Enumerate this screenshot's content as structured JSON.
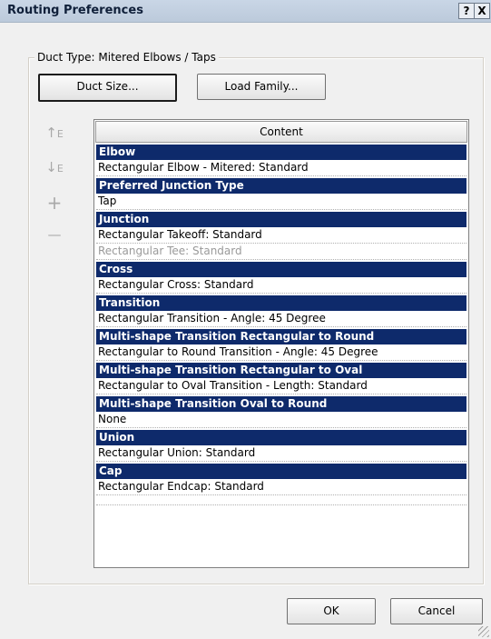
{
  "window": {
    "title": "Routing Preferences",
    "help_glyph": "?",
    "close_glyph": "X"
  },
  "group": {
    "legend": "Duct Type: Mitered Elbows / Taps",
    "duct_size_label": "Duct Size...",
    "load_family_label": "Load Family..."
  },
  "toolbar": {
    "move_up_glyph": "↑",
    "move_down_glyph": "↓",
    "add_glyph": "+",
    "remove_glyph": "—"
  },
  "grid": {
    "header": "Content",
    "sections": [
      {
        "title": "Elbow",
        "rows": [
          {
            "text": "Rectangular Elbow - Mitered: Standard",
            "disabled": false
          }
        ]
      },
      {
        "title": "Preferred Junction Type",
        "rows": [
          {
            "text": "Tap",
            "disabled": false
          }
        ]
      },
      {
        "title": "Junction",
        "rows": [
          {
            "text": "Rectangular Takeoff: Standard",
            "disabled": false
          },
          {
            "text": "Rectangular Tee: Standard",
            "disabled": true
          }
        ]
      },
      {
        "title": "Cross",
        "rows": [
          {
            "text": "Rectangular Cross: Standard",
            "disabled": false
          }
        ]
      },
      {
        "title": "Transition",
        "rows": [
          {
            "text": "Rectangular Transition - Angle: 45 Degree",
            "disabled": false
          }
        ]
      },
      {
        "title": "Multi-shape Transition Rectangular to Round",
        "rows": [
          {
            "text": "Rectangular to Round Transition - Angle: 45 Degree",
            "disabled": false
          }
        ]
      },
      {
        "title": "Multi-shape Transition Rectangular to Oval",
        "rows": [
          {
            "text": "Rectangular to Oval Transition - Length: Standard",
            "disabled": false
          }
        ]
      },
      {
        "title": "Multi-shape Transition Oval to Round",
        "rows": [
          {
            "text": "None",
            "disabled": false
          }
        ]
      },
      {
        "title": "Union",
        "rows": [
          {
            "text": "Rectangular Union: Standard",
            "disabled": false
          }
        ]
      },
      {
        "title": "Cap",
        "rows": [
          {
            "text": "Rectangular Endcap: Standard",
            "disabled": false
          }
        ]
      }
    ]
  },
  "footer": {
    "ok_label": "OK",
    "cancel_label": "Cancel"
  },
  "colors": {
    "section_header_bg": "#0e2a6b",
    "section_header_text": "#ffffff",
    "disabled_text": "#9a9a9a"
  }
}
